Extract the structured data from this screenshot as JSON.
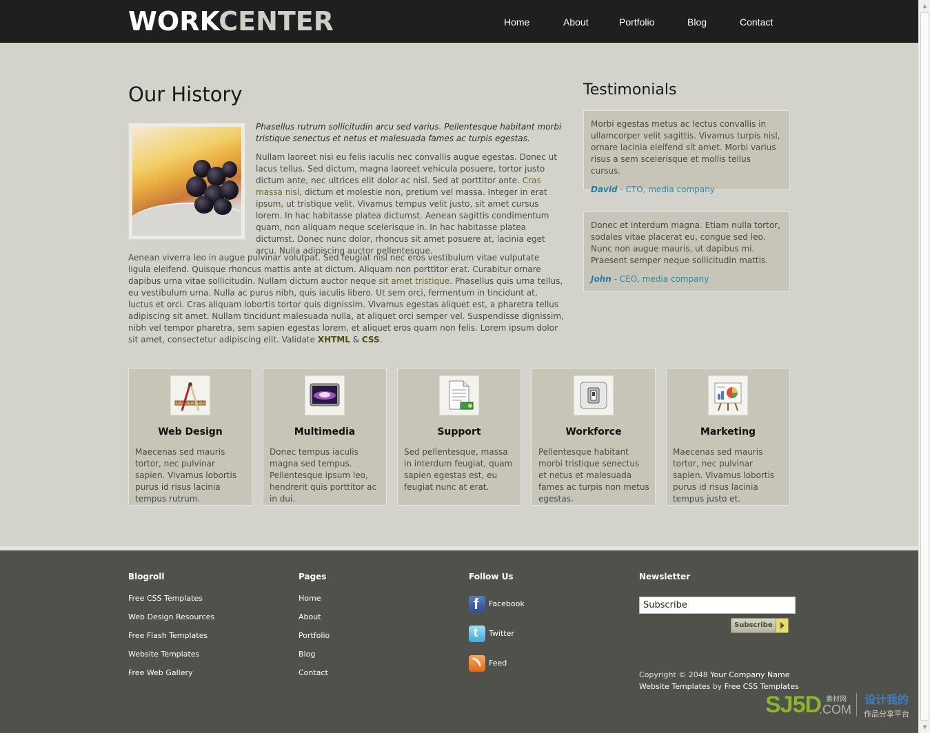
{
  "header": {
    "logo_part1": "WORK",
    "logo_part2": "CENTER",
    "nav": [
      "Home",
      "About",
      "Portfolio",
      "Blog",
      "Contact"
    ]
  },
  "history": {
    "title": "Our History",
    "intro": "Phasellus rutrum sollicitudin arcu sed varius. Pellentesque habitant morbi tristique senectus et netus et malesuada fames ac turpis egestas.",
    "para1_a": "Nullam laoreet nisi eu felis iaculis nec convallis augue egestas. Donec ut lacus tellus. Sed dictum, magna laoreet vehicula posuere, tortor justo dictum ante, nec ultrices elit dolor ac nisl. Sed at porttitor ante. ",
    "para1_link": "Cras massa nisl",
    "para1_b": ", dictum et molestie non, pretium vel massa. Integer in erat ipsum, ut tristique velit. Vivamus tempus velit justo, sit amet cursus lorem. In hac habitasse platea dictumst. Aenean sagittis condimentum quam, non aliquam neque scelerisque in. In hac habitasse platea dictumst. Donec nunc dolor, rhoncus sit amet posuere at, lacinia eget arcu. Nulla adipiscing auctor pellentesque.",
    "para2_a": "Aenean viverra leo in augue pulvinar volutpat. Sed feugiat nisl nec eros vestibulum vitae vulputate ligula eleifend. Quisque rhoncus mattis ante at dictum. Aliquam non porttitor erat. Curabitur ornare dapibus urna vitae sollicitudin. Nullam dictum auctor neque ",
    "para2_link": "sit amet tristique",
    "para2_b": ". Phasellus quis urna tellus, eu vestibulum urna. Nulla ac purus nibh, quis iaculis libero. Ut sem orci, fermentum in tincidunt at, luctus et orci. Cras aliquam lobortis tortor quis dignissim. Vivamus egestas aliquet est, a pharetra tellus adipiscing sit amet. Nullam tincidunt malesuada nulla, at aliquet orci semper vel. Suspendisse dignissim, nibh vel tempor pharetra, sem sapien egestas lorem, et aliquet eros quam non felis. Lorem ipsum dolor sit amet, consectetur adipiscing elit. Validate ",
    "xhtml": "XHTML",
    "amp": " & ",
    "css": "CSS",
    "dot": "."
  },
  "testimonials": {
    "title": "Testimonials",
    "items": [
      {
        "text": "Morbi egestas metus ac lectus convallis in ullamcorper velit sagittis. Vivamus turpis nisl, ornare lacinia eleifend sit amet. Morbi varius risus a sem scelerisque et mollis tellus cursus.",
        "name": "David",
        "role": " - CTO, media company"
      },
      {
        "text": "Donec et interdum magna. Etiam nulla tortor, sodales vitae placerat eu, congue sed leo. Nunc non augue mauris, ut dapibus mi. Praesent semper neque sollicitudin mattis.",
        "name": "John",
        "role": " - CEO, media company"
      }
    ]
  },
  "features": [
    {
      "icon": "drafting-tools-icon",
      "title": "Web Design",
      "text": "Maecenas sed mauris tortor, nec pulvinar sapien. Vivamus lobortis purus id risus lacinia tempus rutrum."
    },
    {
      "icon": "monitor-icon",
      "title": "Multimedia",
      "text": "Donec tempus iaculis magna sed tempus. Pellentesque ipsum leo, hendrerit quis porttitor ac in dui."
    },
    {
      "icon": "document-icon",
      "title": "Support",
      "text": "Sed pellentesque, massa in interdum feugiat, quam sapien egestas est, eu feugiat nunc at erat."
    },
    {
      "icon": "switch-icon",
      "title": "Workforce",
      "text": "Pellentesque habitant morbi tristique senectus et netus et malesuada fames ac turpis non metus egestas."
    },
    {
      "icon": "presentation-icon",
      "title": "Marketing",
      "text": "Maecenas sed mauris tortor, nec pulvinar sapien. Vivamus lobortis purus id risus lacinia tempus justo et."
    }
  ],
  "footer": {
    "blogroll_title": "Blogroll",
    "blogroll": [
      "Free CSS Templates",
      "Web Design Resources",
      "Free Flash Templates",
      "Website Templates",
      "Free Web Gallery"
    ],
    "pages_title": "Pages",
    "pages": [
      "Home",
      "About",
      "Portfolio",
      "Blog",
      "Contact"
    ],
    "follow_title": "Follow Us",
    "follow": [
      {
        "icon": "facebook-icon",
        "label": "Facebook"
      },
      {
        "icon": "twitter-icon",
        "label": "Twitter"
      },
      {
        "icon": "rss-icon",
        "label": "Feed"
      }
    ],
    "newsletter_title": "Newsletter",
    "newsletter_value": "Subscribe",
    "subscribe_button": "Subscribe",
    "copy_a": "Copyright © 2048 ",
    "copy_company": "Your Company Name",
    "copy_b": "Website Templates",
    "copy_by": " by ",
    "copy_c": "Free CSS Templates"
  },
  "watermark": {
    "brand": "SJ5D",
    "dotcom": ".COM",
    "cn_small": "素材网",
    "cn_title": "设计我的",
    "cn_sub": "作品分享平台"
  }
}
